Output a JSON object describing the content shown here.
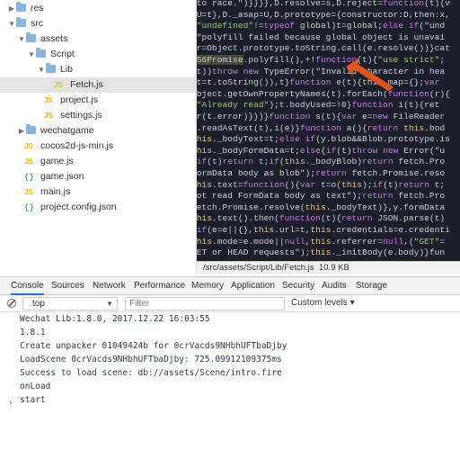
{
  "tree": {
    "items": [
      {
        "label": "res",
        "kind": "folder",
        "expanded": false
      },
      {
        "label": "src",
        "kind": "folder",
        "expanded": true
      },
      {
        "label": "assets",
        "kind": "folder",
        "expanded": true
      },
      {
        "label": "Script",
        "kind": "folder",
        "expanded": true
      },
      {
        "label": "Lib",
        "kind": "folder",
        "expanded": true
      },
      {
        "label": "Fetch.js",
        "kind": "js",
        "selected": true
      },
      {
        "label": "project.js",
        "kind": "js"
      },
      {
        "label": "settings.js",
        "kind": "js"
      },
      {
        "label": "wechatgame",
        "kind": "folder",
        "expanded": false
      },
      {
        "label": "cocos2d-js-min.js",
        "kind": "js"
      },
      {
        "label": "game.js",
        "kind": "js"
      },
      {
        "label": "game.json",
        "kind": "json"
      },
      {
        "label": "main.js",
        "kind": "js"
      },
      {
        "label": "project.config.json",
        "kind": "json"
      }
    ]
  },
  "editor": {
    "lines": [
      " to race.\")}}}},D.resolve=s,D.reject=function(t){v",
      "{U=t},D._asap=U,D.prototype={constructor:D,then:x,",
      "(\"undefined\"!=typeof global)t=global;else if(\"und",
      "(\"polyfill failed because global object is unavai",
      "{r=Object.prototype.toString.call(e.resolve())}cat",
      "ES6Promise.polyfill(),+!function(t){\"use strict\";",
      "(t))throw new TypeError(\"Invalid character in hea",
      "(t=t.toString()),t}function e(t){this.map={};var",
      "Object.getOwnPropertyNames(t).forEach(function(r){",
      "(\"Already read\");t.bodyUsed=!0}function i(t){ret",
      "{r(t.error)}})}function s(t){var e=new FileReader",
      "e.readAsText(t),i(e)}function a(){return this.bod",
      "this._bodyText=t;else if(y.blob&&Blob.prototype.is",
      "this._bodyFormData=t;else{if(t)throw new Error(\"u",
      ";if(t)return t;if(this._bodyBlob)return fetch.Pro",
      "FormData body as blob\");return fetch.Promise.reso",
      "this.text=function(){var t=o(this);if(t)return t;",
      "not read FormData body as text\");return fetch.Pro",
      "fetch.Promise.resolve(this._bodyText)},y.formData",
      "this.text().then(function(t){return JSON.parse(t)",
      "{if(e=e||{},this.url=t,this.credentials=e.credenti",
      "this.mode=e.mode||null,this.referrer=null,(\"GET\"=",
      "GET or HEAD requests\");this._initBody(e.body)}fun"
    ],
    "status_path": "/src/assets/Script/Lib/Fetch.js",
    "status_size": "10.9 KB"
  },
  "devtools": {
    "tabs": [
      "Console",
      "Sources",
      "Network",
      "Performance",
      "Memory",
      "Application",
      "Security",
      "Audits",
      "Storage"
    ],
    "active_tab": "Console",
    "context": "top",
    "filter_placeholder": "Filter",
    "levels": "Custom levels ▾"
  },
  "console": {
    "lines": [
      "Wechat Lib:1.8.0, 2017.12.22 16:03:55",
      "1.8.1",
      "Create unpacker 01049424b for 0crVacds9NHbhUFTbaDjby",
      "LoadScene 0crVacds9NHbhUFTbaDjby: 725.09912109375ms",
      "Success to load scene: db://assets/Scene/intro.fire",
      "onLoad",
      "start"
    ],
    "prompt": "›"
  }
}
